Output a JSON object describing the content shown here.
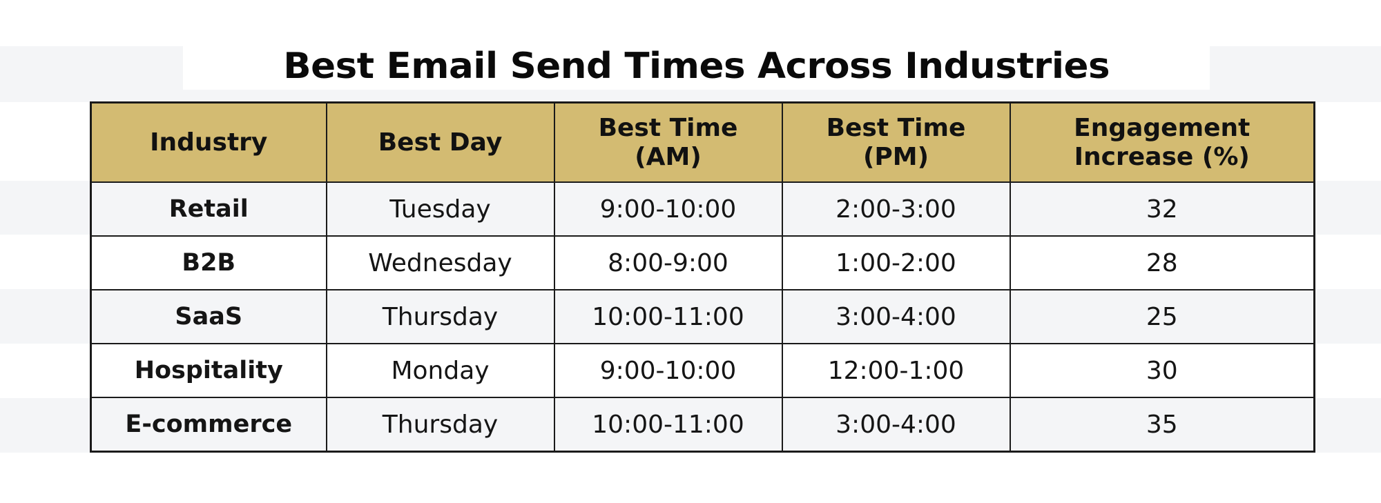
{
  "title": "Best Email Send Times Across Industries",
  "colors": {
    "header_fill": "#D3BB72",
    "border": "#1a1a1a",
    "row_band_gray": "#F4F5F7",
    "row_band_white": "#FFFFFF"
  },
  "table": {
    "headers": [
      {
        "line1": "Industry",
        "line2": ""
      },
      {
        "line1": "Best Day",
        "line2": ""
      },
      {
        "line1": "Best Time",
        "line2": "(AM)"
      },
      {
        "line1": "Best Time",
        "line2": "(PM)"
      },
      {
        "line1": "Engagement",
        "line2": "Increase (%)"
      }
    ],
    "rows": [
      {
        "industry": "Retail",
        "best_day": "Tuesday",
        "best_time_am": "9:00-10:00",
        "best_time_pm": "2:00-3:00",
        "engagement_increase": "32"
      },
      {
        "industry": "B2B",
        "best_day": "Wednesday",
        "best_time_am": "8:00-9:00",
        "best_time_pm": "1:00-2:00",
        "engagement_increase": "28"
      },
      {
        "industry": "SaaS",
        "best_day": "Thursday",
        "best_time_am": "10:00-11:00",
        "best_time_pm": "3:00-4:00",
        "engagement_increase": "25"
      },
      {
        "industry": "Hospitality",
        "best_day": "Monday",
        "best_time_am": "9:00-10:00",
        "best_time_pm": "12:00-1:00",
        "engagement_increase": "30"
      },
      {
        "industry": "E-commerce",
        "best_day": "Thursday",
        "best_time_am": "10:00-11:00",
        "best_time_pm": "3:00-4:00",
        "engagement_increase": "35"
      }
    ]
  }
}
